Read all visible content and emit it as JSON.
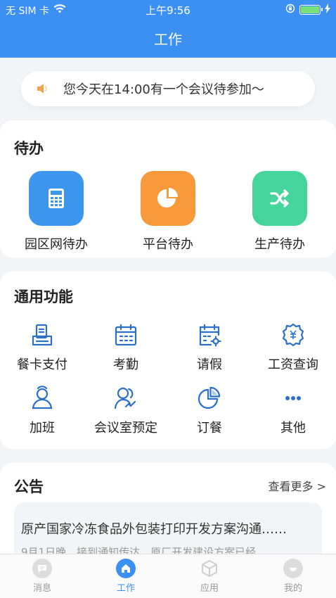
{
  "status_bar": {
    "carrier": "无 SIM 卡",
    "time": "上午9:56",
    "battery_level": 1.0
  },
  "header": {
    "title": "工作"
  },
  "banner": {
    "text": "您今天在14:00有一个会议待参加～",
    "icon": "speaker-icon"
  },
  "todo": {
    "title": "待办",
    "items": [
      {
        "label": "园区网待办",
        "icon": "calculator-icon",
        "color": "#3d96ee"
      },
      {
        "label": "平台待办",
        "icon": "pie-chart-icon",
        "color": "#f89a3c"
      },
      {
        "label": "生产待办",
        "icon": "shuffle-icon",
        "color": "#45d59c"
      }
    ]
  },
  "functions": {
    "title": "通用功能",
    "items": [
      {
        "label": "餐卡支付",
        "icon": "card-reader-icon"
      },
      {
        "label": "考勤",
        "icon": "calendar-icon"
      },
      {
        "label": "请假",
        "icon": "calendar-gear-icon"
      },
      {
        "label": "工资查询",
        "icon": "salary-badge-icon"
      },
      {
        "label": "加班",
        "icon": "user-icon"
      },
      {
        "label": "会议室预定",
        "icon": "users-icon"
      },
      {
        "label": "订餐",
        "icon": "pie-icon"
      },
      {
        "label": "其他",
        "icon": "more-dots-icon"
      }
    ]
  },
  "announcements": {
    "title": "公告",
    "more_label": "查看更多 >",
    "items": [
      {
        "title": "原产国家冷冻食品外包装打印开发方案沟通……",
        "subtitle": "9月1日晚，接到通知传达，原厂开发建设方案已经"
      }
    ]
  },
  "tabbar": {
    "items": [
      {
        "label": "消息",
        "icon": "message-icon",
        "active": false
      },
      {
        "label": "工作",
        "icon": "home-icon",
        "active": true
      },
      {
        "label": "应用",
        "icon": "cube-icon",
        "active": false
      },
      {
        "label": "我的",
        "icon": "profile-icon",
        "active": false
      }
    ]
  },
  "colors": {
    "primary": "#3c8ff3",
    "background": "#f3f4f7",
    "icon_blue": "#2b6fc8"
  }
}
